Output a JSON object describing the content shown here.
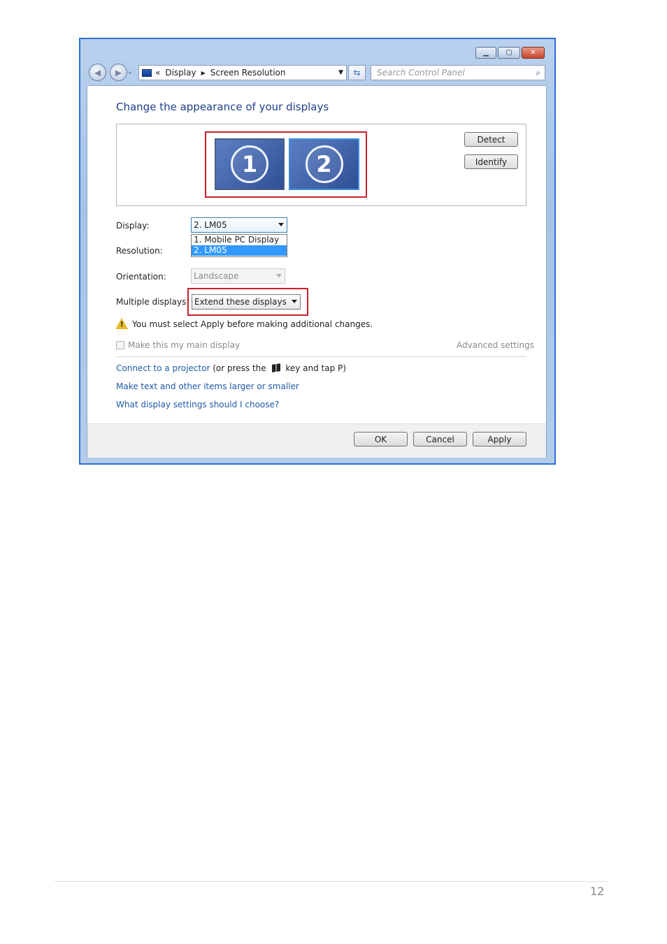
{
  "window": {
    "caption_buttons": {
      "minimize_icon": "minimize-icon",
      "maximize_icon": "maximize-icon",
      "close_icon": "close-icon"
    }
  },
  "nav": {
    "back_icon": "back-arrow-icon",
    "forward_icon": "forward-arrow-icon",
    "breadcrumb": {
      "overflow": "«",
      "items": [
        "Display",
        "Screen Resolution"
      ]
    },
    "refresh_icon": "refresh-icon",
    "search_placeholder": "Search Control Panel"
  },
  "heading": "Change the appearance of your displays",
  "preview": {
    "monitors": [
      "1",
      "2"
    ],
    "detect_label": "Detect",
    "identify_label": "Identify"
  },
  "form": {
    "display_label": "Display:",
    "display_value": "2. LM05",
    "display_options": [
      "1. Mobile PC Display",
      "2. LM05"
    ],
    "resolution_label": "Resolution:",
    "orientation_label": "Orientation:",
    "orientation_value": "Landscape",
    "multiple_label": "Multiple displays:",
    "multiple_value": "Extend these displays"
  },
  "warning": {
    "icon": "warning-icon",
    "text": "You must select Apply before making additional changes."
  },
  "main_display_label": "Make this my main display",
  "advanced_settings": "Advanced settings",
  "links": {
    "projector_link": "Connect to a projector",
    "projector_text_1": "(or press the",
    "windows_key_icon": "windows-logo-icon",
    "projector_text_2": "key and tap P)",
    "text_size_link": "Make text and other items larger or smaller",
    "help_link": "What display settings should I choose?"
  },
  "buttons": {
    "ok": "OK",
    "cancel": "Cancel",
    "apply": "Apply"
  },
  "page_number": "12",
  "colors": {
    "highlight_red": "#c8202b",
    "selection_blue": "#3399ff",
    "link_blue": "#1e5aa8"
  }
}
